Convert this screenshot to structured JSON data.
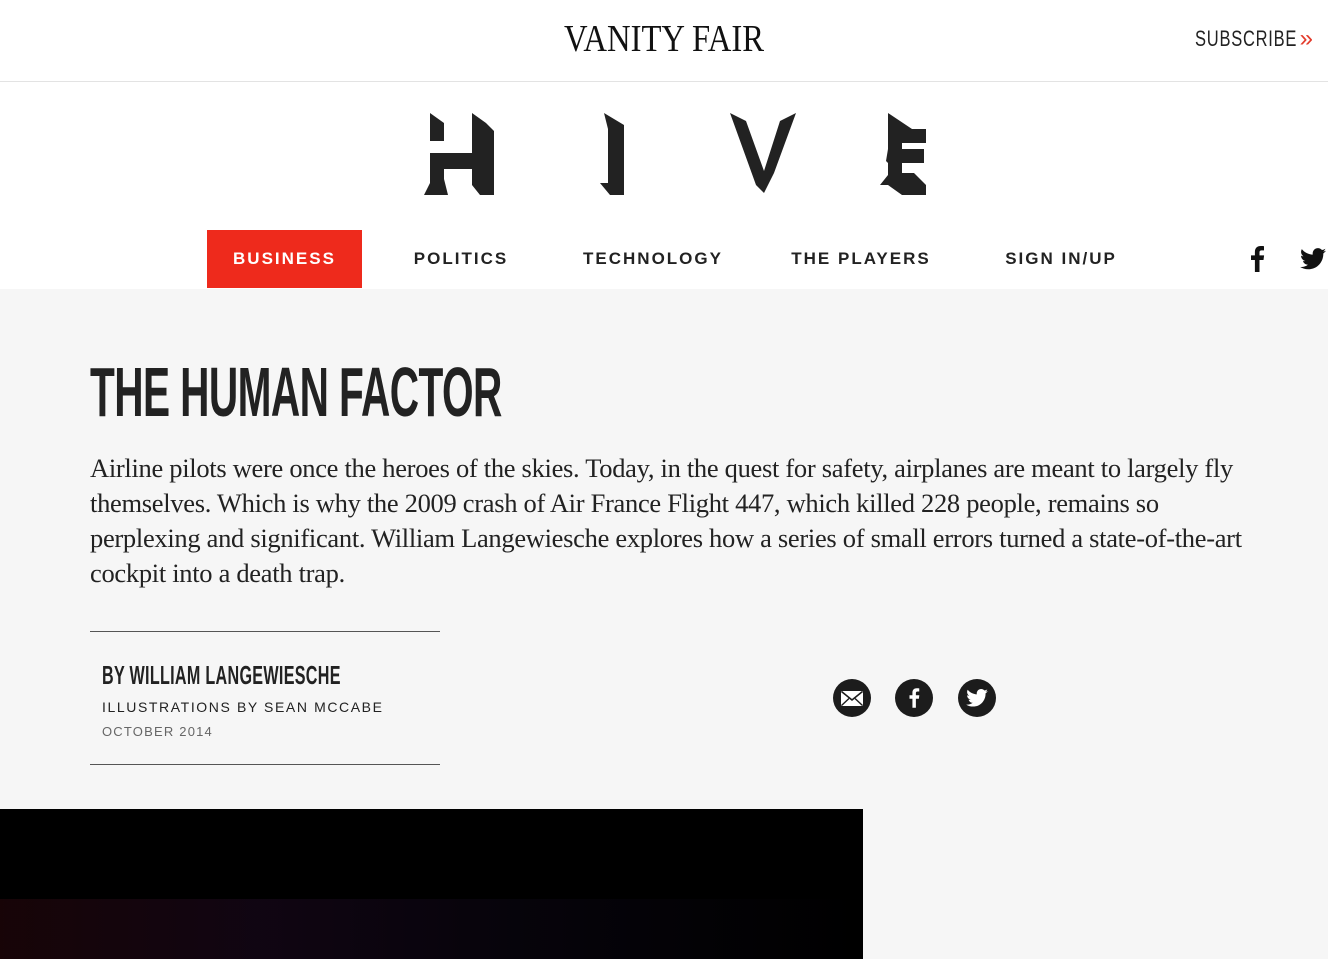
{
  "header": {
    "brand": "VANITY FAIR",
    "subscribe_label": "SUBSCRIBE",
    "subscribe_icon": "double-chevron-right-icon"
  },
  "section_logo": {
    "letters": [
      "H",
      "I",
      "V",
      "E"
    ]
  },
  "nav": {
    "items": [
      {
        "label": "BUSINESS",
        "active": true
      },
      {
        "label": "POLITICS",
        "active": false
      },
      {
        "label": "TECHNOLOGY",
        "active": false
      },
      {
        "label": "THE PLAYERS",
        "active": false
      },
      {
        "label": "SIGN IN/UP",
        "active": false
      }
    ],
    "social": [
      "facebook-icon",
      "twitter-icon"
    ]
  },
  "article": {
    "headline": "THE HUMAN FACTOR",
    "dek": "Airline pilots were once the heroes of the skies. Today, in the quest for safety, airplanes are meant to largely fly themselves. Which is why the 2009 crash of Air France Flight 447, which killed 228 people, remains so perplexing and significant. William Langewiesche explores how a series of small errors turned a state-of-the-art cockpit into a death trap.",
    "byline": "BY WILLIAM LANGEWIESCHE",
    "illustrations": "ILLUSTRATIONS BY SEAN MCCABE",
    "date": "OCTOBER 2014",
    "share": [
      "email-icon",
      "facebook-icon",
      "twitter-icon"
    ]
  },
  "colors": {
    "accent": "#ee2a1c",
    "text": "#222222",
    "background": "#f6f6f6",
    "subscribe_chevron": "#e33b2b"
  }
}
